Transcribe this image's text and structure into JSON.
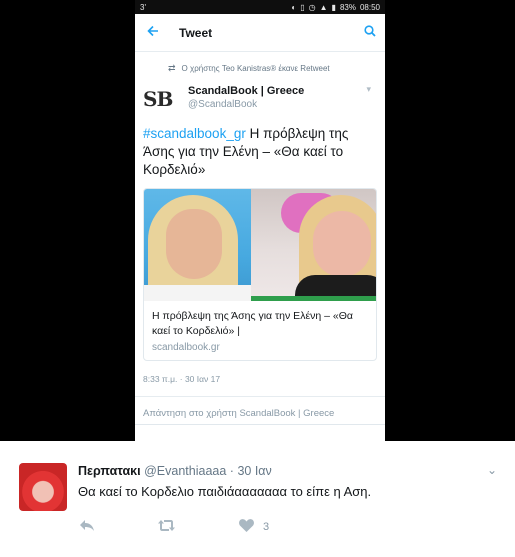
{
  "status_bar": {
    "left_text": "3'",
    "battery": "83%",
    "time": "08:50"
  },
  "app_bar": {
    "title": "Tweet",
    "back_icon": "arrow-left-icon",
    "search_icon": "search-icon"
  },
  "retweet_context": {
    "text": "Ο χρήστης Teo Kanistras® έκανε Retweet"
  },
  "tweet": {
    "logo_text": "SB",
    "author_name": "ScandalBook | Greece",
    "author_handle": "@ScandalBook",
    "hashtag": "#scandalbook_gr",
    "text": " Η πρόβλεψη της Άσης για την Ελένη – «Θα καεί το Κορδελιό»",
    "card": {
      "title": "Η πρόβλεψη της Άσης για την Ελένη – «Θα καεί το Κορδελιό» |",
      "domain": "scandalbook.gr"
    },
    "timestamp": "8:33 π.μ. · 30 Ιαν 17",
    "reply_placeholder": "Απάντηση στο χρήστη ScandalBook | Greece"
  },
  "embedded_tweet": {
    "name": "Περπατακι",
    "handle": "@Evanthiaaaa",
    "separator": "·",
    "date": "30 Ιαν",
    "text": "Θα καεί το Κορδελιο παιδιάααααααα το είπε η Αση.",
    "like_count": "3",
    "accent_color": "#1da1f2"
  }
}
